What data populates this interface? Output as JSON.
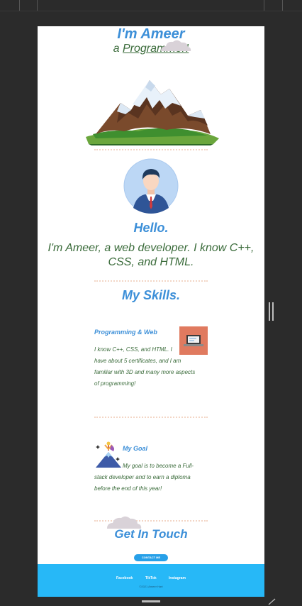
{
  "hero": {
    "title": "I'm Ameer",
    "sub_prefix": "a ",
    "sub_role": "Programmer!"
  },
  "about": {
    "heading": "Hello.",
    "text": "I'm Ameer, a web developer. I know C++, CSS, and HTML."
  },
  "skills": {
    "heading": "My Skills.",
    "cards": [
      {
        "title": "Programming & Web",
        "lines": [
          "I know C++, CSS, and HTML. I",
          "have about 5 certificates, and I am",
          "familiar with 3D and many more aspects",
          "of programming!"
        ],
        "icon": "laptop-icon"
      },
      {
        "title": "My Goal",
        "lines": [
          "My goal is to become a Full-",
          "stack developer and to earn a diploma",
          "before the end of this year!"
        ],
        "icon": "mountain-goal-icon"
      }
    ]
  },
  "contact": {
    "heading": "Get In Touch",
    "button_label": "CONTACT ME"
  },
  "footer": {
    "links": [
      "Facebook",
      "TikTok",
      "Instagram"
    ],
    "copyright": "©2021 Ameer Hart"
  },
  "colors": {
    "accent": "#3c8fd8",
    "text_green": "#3a6b3a",
    "footer_bg": "#27b8f7",
    "divider": "#f3d6c6"
  }
}
